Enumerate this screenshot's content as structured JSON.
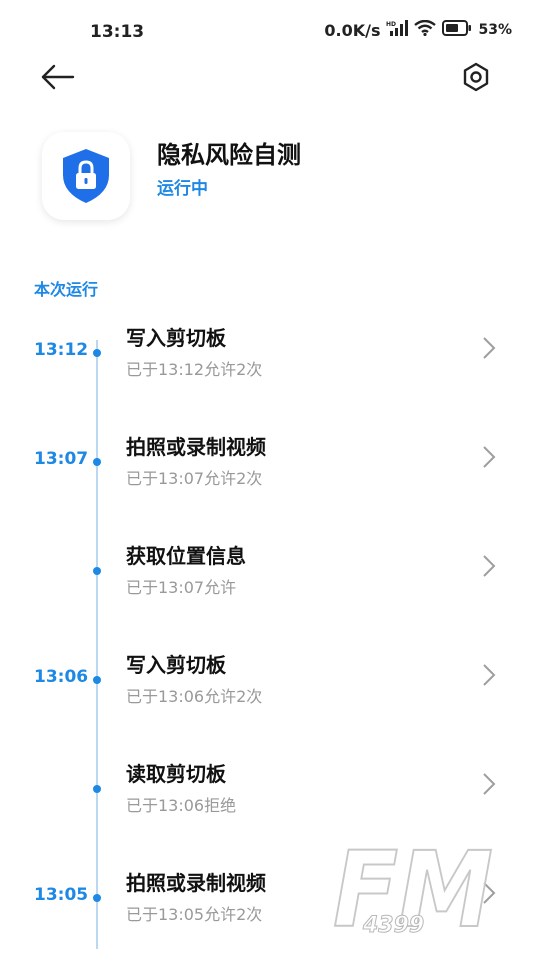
{
  "status_bar": {
    "time": "13:13",
    "network_speed": "0.0K/s",
    "battery_percent": "53%"
  },
  "app": {
    "name": "隐私风险自测",
    "status": "运行中"
  },
  "section": {
    "title": "本次运行"
  },
  "entries": [
    {
      "time": "13:12",
      "title": "写入剪切板",
      "subtitle": "已于13:12允许2次"
    },
    {
      "time": "13:07",
      "title": "拍照或录制视频",
      "subtitle": "已于13:07允许2次"
    },
    {
      "time": "",
      "title": "获取位置信息",
      "subtitle": "已于13:07允许"
    },
    {
      "time": "13:06",
      "title": "写入剪切板",
      "subtitle": "已于13:06允许2次"
    },
    {
      "time": "",
      "title": "读取剪切板",
      "subtitle": "已于13:06拒绝"
    },
    {
      "time": "13:05",
      "title": "拍照或录制视频",
      "subtitle": "已于13:05允许2次"
    }
  ],
  "watermark": {
    "text": "FM",
    "sub": "4399"
  },
  "colors": {
    "accent": "#1E88E5",
    "timeline": "#bcd7f0",
    "subtext": "#999999"
  }
}
